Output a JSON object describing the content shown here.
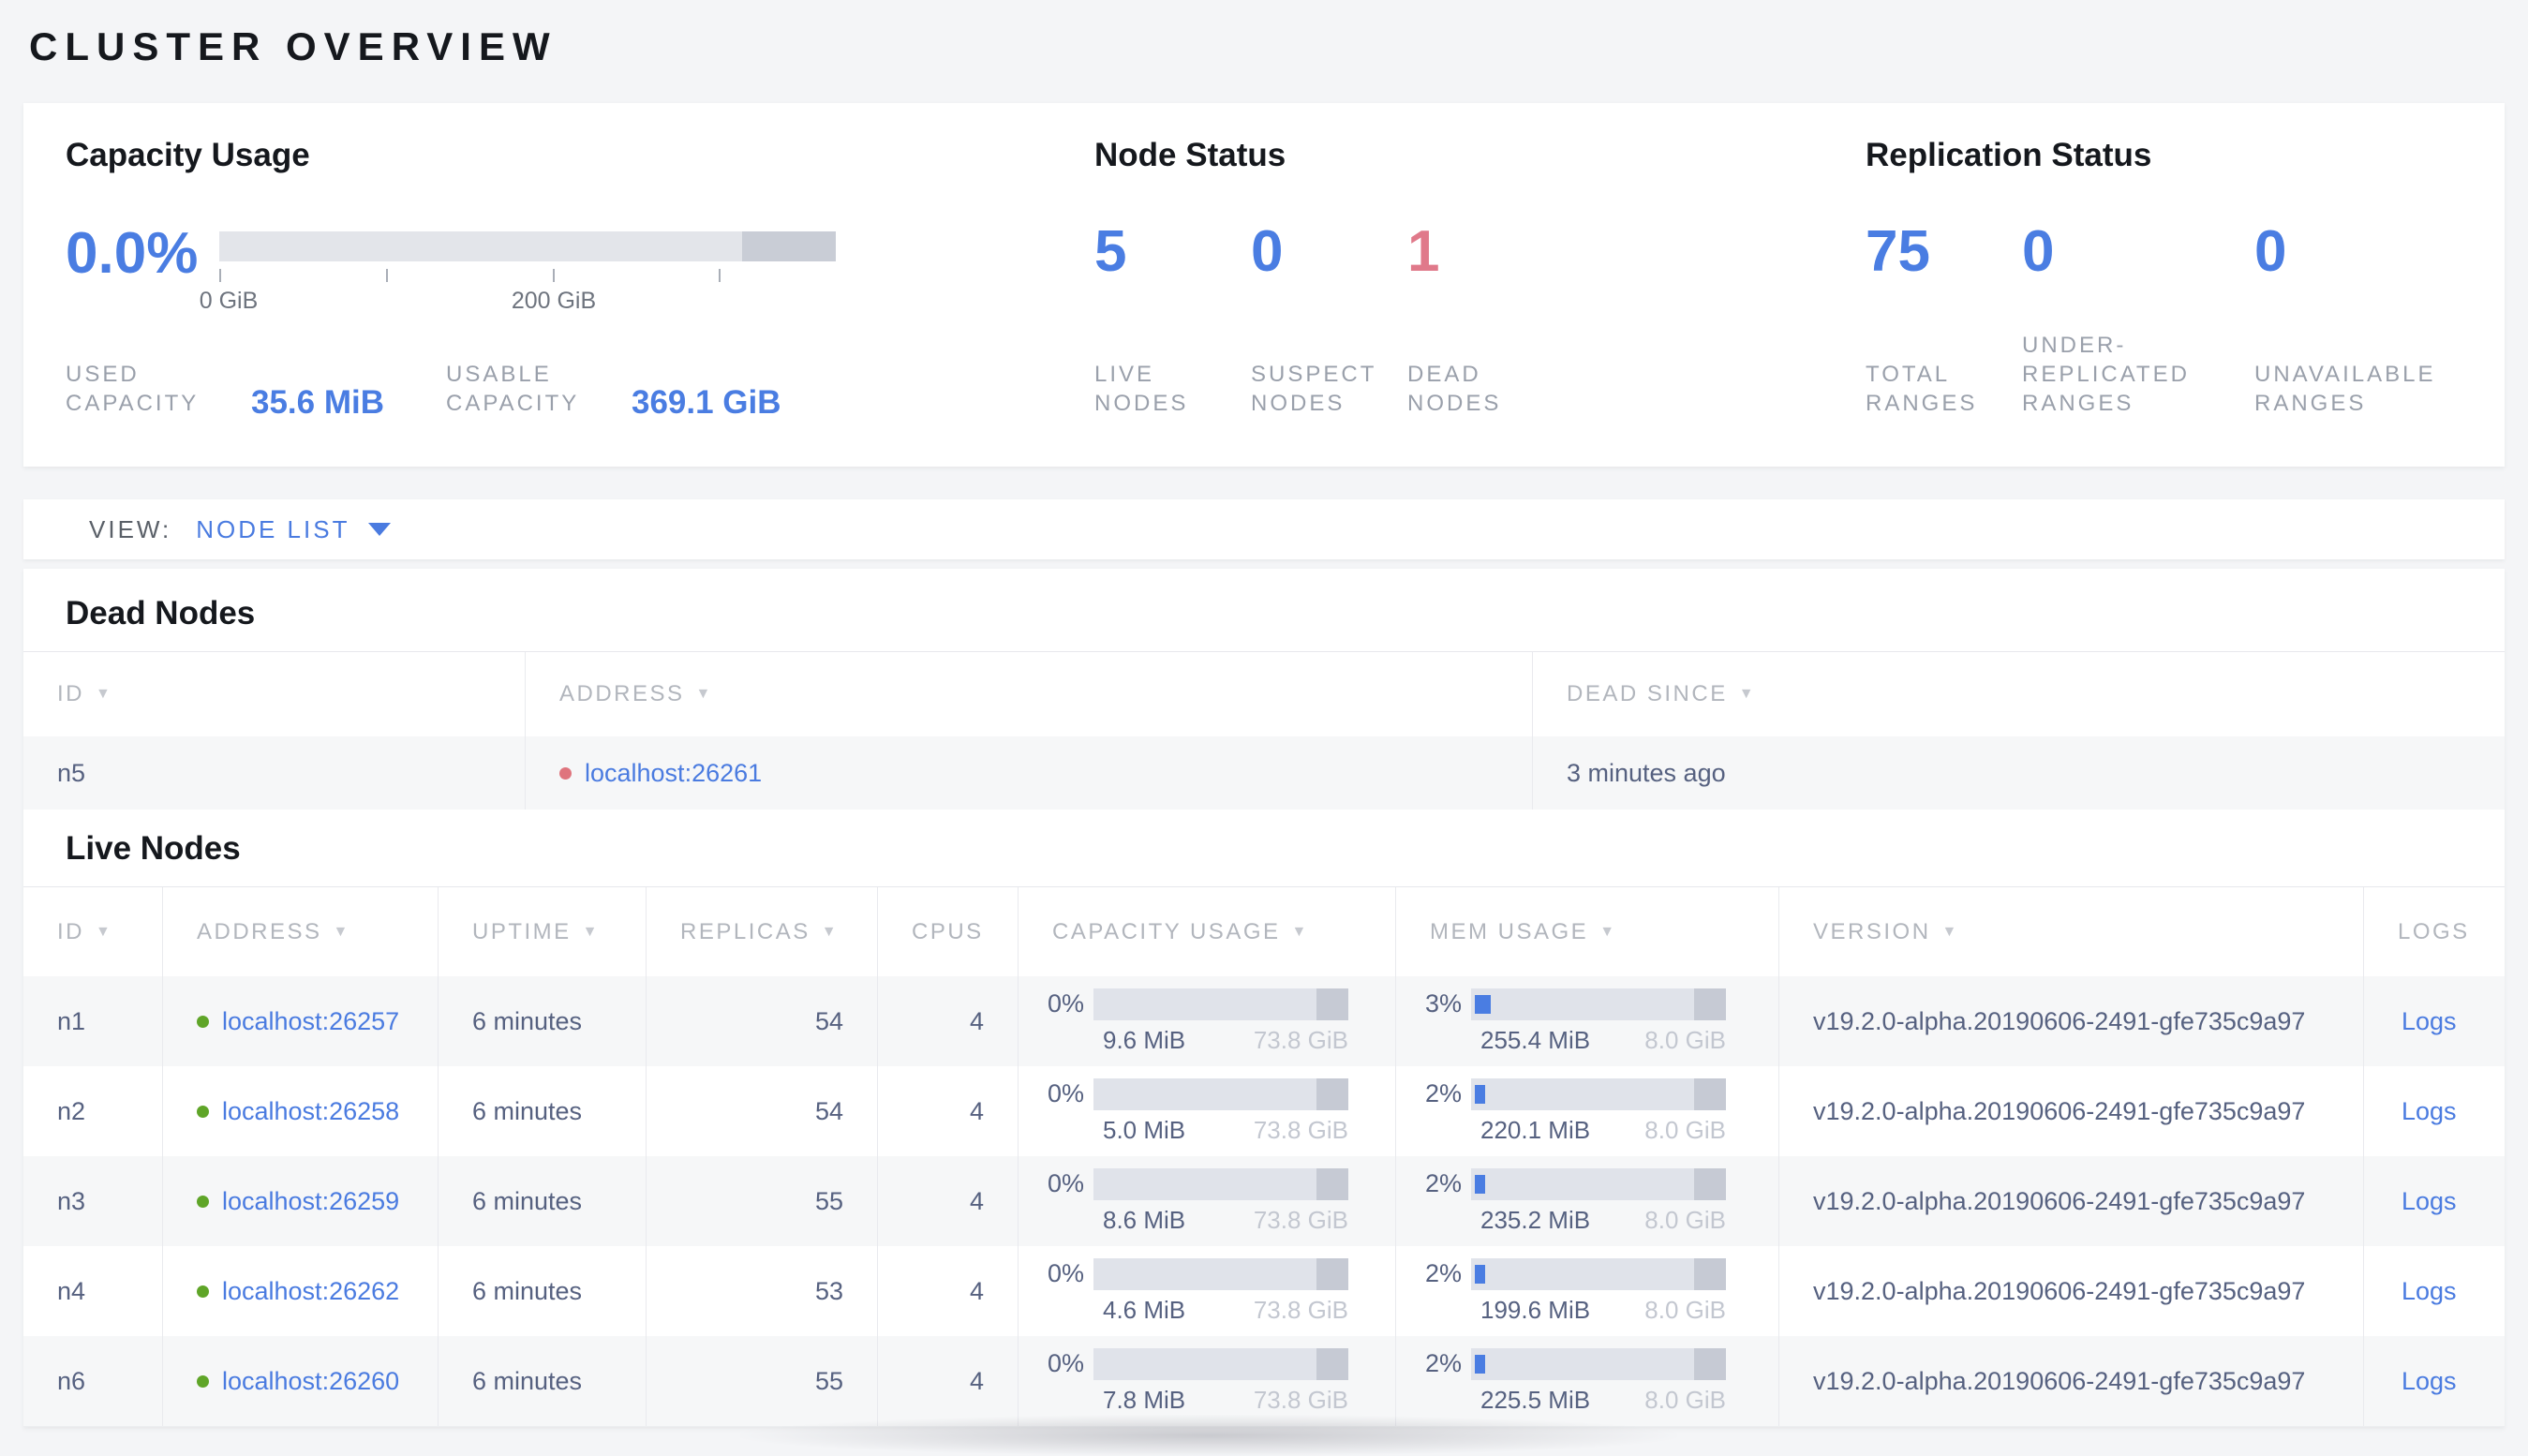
{
  "page": {
    "title": "CLUSTER OVERVIEW"
  },
  "colors": {
    "accent_blue": "#4a7de2",
    "link_blue": "#4a7be0",
    "alert_red": "#e0798a",
    "live_dot_green": "#5fa528",
    "dead_dot_red": "#df747d",
    "bar_track": "#e3e5ea",
    "bar_dark_segment": "#c9cdd6"
  },
  "summary": {
    "capacity": {
      "title": "Capacity Usage",
      "percent": "0.0%",
      "tick_label_0": "0 GiB",
      "tick_label_200": "200 GiB",
      "used": {
        "label": "USED CAPACITY",
        "value": "35.6 MiB"
      },
      "usable": {
        "label": "USABLE CAPACITY",
        "value": "369.1 GiB"
      }
    },
    "node_status": {
      "title": "Node Status",
      "live": {
        "value": "5",
        "label": "LIVE NODES"
      },
      "suspect": {
        "value": "0",
        "label": "SUSPECT NODES"
      },
      "dead": {
        "value": "1",
        "label": "DEAD NODES"
      }
    },
    "replication": {
      "title": "Replication Status",
      "total": {
        "value": "75",
        "label": "TOTAL RANGES"
      },
      "under": {
        "value": "0",
        "label": "UNDER-REPLICATED RANGES"
      },
      "unavailable": {
        "value": "0",
        "label": "UNAVAILABLE RANGES"
      }
    }
  },
  "view_bar": {
    "label": "VIEW:",
    "selected": "NODE LIST"
  },
  "dead_nodes": {
    "title": "Dead Nodes",
    "columns": {
      "id": "ID",
      "address": "ADDRESS",
      "dead_since": "DEAD SINCE"
    },
    "rows": [
      {
        "id": "n5",
        "address": "localhost:26261",
        "dead_since": "3 minutes ago"
      }
    ]
  },
  "live_nodes": {
    "title": "Live Nodes",
    "columns": {
      "id": "ID",
      "address": "ADDRESS",
      "uptime": "UPTIME",
      "replicas": "REPLICAS",
      "cpus": "CPUS",
      "capacity": "CAPACITY USAGE",
      "mem": "MEM USAGE",
      "version": "VERSION",
      "logs": "LOGS"
    },
    "logs_label": "Logs",
    "rows": [
      {
        "id": "n1",
        "address": "localhost:26257",
        "uptime": "6 minutes",
        "replicas": "54",
        "cpus": "4",
        "capacity_percent": "0%",
        "capacity_used": "9.6 MiB",
        "capacity_total": "73.8 GiB",
        "mem_percent": "3%",
        "mem_used": "255.4 MiB",
        "mem_total": "8.0 GiB",
        "version": "v19.2.0-alpha.20190606-2491-gfe735c9a97"
      },
      {
        "id": "n2",
        "address": "localhost:26258",
        "uptime": "6 minutes",
        "replicas": "54",
        "cpus": "4",
        "capacity_percent": "0%",
        "capacity_used": "5.0 MiB",
        "capacity_total": "73.8 GiB",
        "mem_percent": "2%",
        "mem_used": "220.1 MiB",
        "mem_total": "8.0 GiB",
        "version": "v19.2.0-alpha.20190606-2491-gfe735c9a97"
      },
      {
        "id": "n3",
        "address": "localhost:26259",
        "uptime": "6 minutes",
        "replicas": "55",
        "cpus": "4",
        "capacity_percent": "0%",
        "capacity_used": "8.6 MiB",
        "capacity_total": "73.8 GiB",
        "mem_percent": "2%",
        "mem_used": "235.2 MiB",
        "mem_total": "8.0 GiB",
        "version": "v19.2.0-alpha.20190606-2491-gfe735c9a97"
      },
      {
        "id": "n4",
        "address": "localhost:26262",
        "uptime": "6 minutes",
        "replicas": "53",
        "cpus": "4",
        "capacity_percent": "0%",
        "capacity_used": "4.6 MiB",
        "capacity_total": "73.8 GiB",
        "mem_percent": "2%",
        "mem_used": "199.6 MiB",
        "mem_total": "8.0 GiB",
        "version": "v19.2.0-alpha.20190606-2491-gfe735c9a97"
      },
      {
        "id": "n6",
        "address": "localhost:26260",
        "uptime": "6 minutes",
        "replicas": "55",
        "cpus": "4",
        "capacity_percent": "0%",
        "capacity_used": "7.8 MiB",
        "capacity_total": "73.8 GiB",
        "mem_percent": "2%",
        "mem_used": "225.5 MiB",
        "mem_total": "8.0 GiB",
        "version": "v19.2.0-alpha.20190606-2491-gfe735c9a97"
      }
    ]
  }
}
